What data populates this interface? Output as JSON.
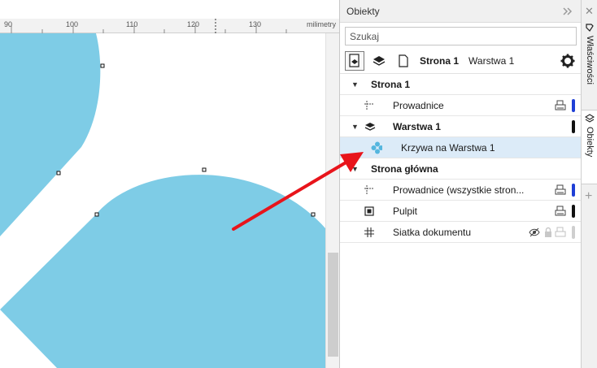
{
  "ruler": {
    "labels": [
      "90",
      "100",
      "110",
      "120",
      "130"
    ],
    "unit": "milimetry"
  },
  "panel": {
    "title": "Obiekty",
    "search_placeholder": "Szukaj",
    "toolbar": {
      "page_label": "Strona 1",
      "layer_label": "Warstwa 1"
    },
    "rows": [
      {
        "label": "Strona 1",
        "bold": true,
        "caret": true
      },
      {
        "label": "Prowadnice",
        "bar_color": "#1f3fd6"
      },
      {
        "label": "Warstwa 1",
        "bold": true,
        "caret": true,
        "bar_color": "#111111"
      },
      {
        "label": "Krzywa na Warstwa 1",
        "selected": true
      },
      {
        "label": "Strona główna",
        "bold": true,
        "caret": true
      },
      {
        "label": "Prowadnice (wszystkie stron...",
        "bar_color": "#1f3fd6"
      },
      {
        "label": "Pulpit",
        "bar_color": "#111111"
      },
      {
        "label": "Siatka dokumentu",
        "bar_color": "#cfcfcf"
      }
    ]
  },
  "side_tabs": {
    "properties": "Właściwości",
    "objects": "Obiekty"
  },
  "colors": {
    "shape_fill": "#7ecce6",
    "arrow": "#e8141b",
    "selected_row": "#dcebf8",
    "accent_blue": "#1f3fd6"
  }
}
